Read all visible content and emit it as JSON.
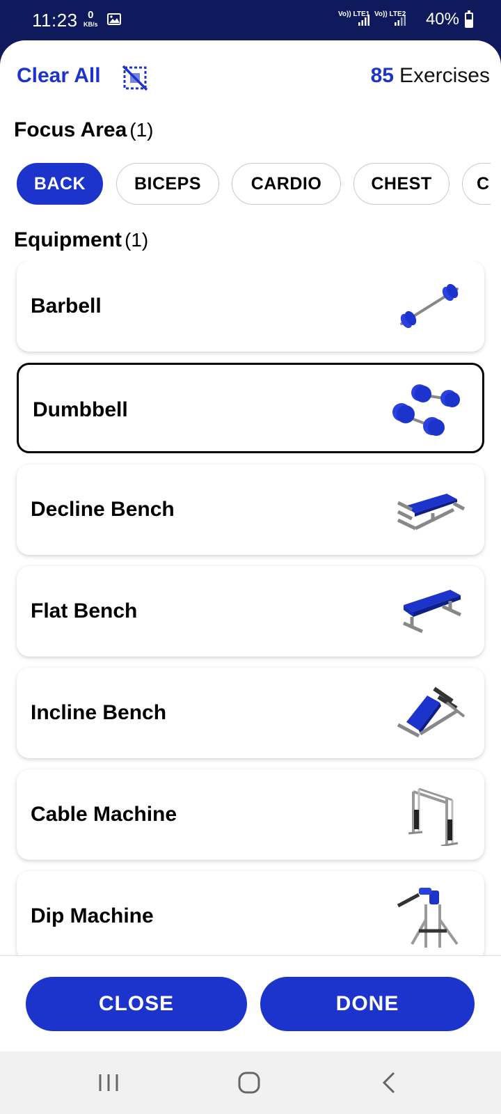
{
  "status": {
    "time": "11:23",
    "net_speed": "0",
    "net_unit": "KB/s",
    "sim1": "Vo)) LTE1",
    "sim2": "Vo)) LTE2",
    "battery": "40%",
    "battery_level": 0.4
  },
  "header": {
    "clear_all": "Clear All",
    "exercise_count": "85",
    "exercise_label": "Exercises"
  },
  "focus": {
    "title": "Focus Area",
    "count": "(1)",
    "chips": [
      {
        "label": "BACK",
        "selected": true
      },
      {
        "label": "BICEPS",
        "selected": false
      },
      {
        "label": "CARDIO",
        "selected": false
      },
      {
        "label": "CHEST",
        "selected": false
      },
      {
        "label": "C",
        "selected": false
      }
    ]
  },
  "equipment": {
    "title": "Equipment",
    "count": "(1)",
    "items": [
      {
        "label": "Barbell",
        "icon": "barbell-icon",
        "selected": false
      },
      {
        "label": "Dumbbell",
        "icon": "dumbbell-icon",
        "selected": true
      },
      {
        "label": "Decline Bench",
        "icon": "decline-bench-icon",
        "selected": false
      },
      {
        "label": "Flat Bench",
        "icon": "flat-bench-icon",
        "selected": false
      },
      {
        "label": "Incline Bench",
        "icon": "incline-bench-icon",
        "selected": false
      },
      {
        "label": "Cable Machine",
        "icon": "cable-machine-icon",
        "selected": false
      },
      {
        "label": "Dip Machine",
        "icon": "dip-machine-icon",
        "selected": false
      }
    ]
  },
  "actions": {
    "close": "CLOSE",
    "done": "DONE"
  },
  "colors": {
    "accent": "#1c33cc",
    "header_bg": "#0e1a5c"
  }
}
